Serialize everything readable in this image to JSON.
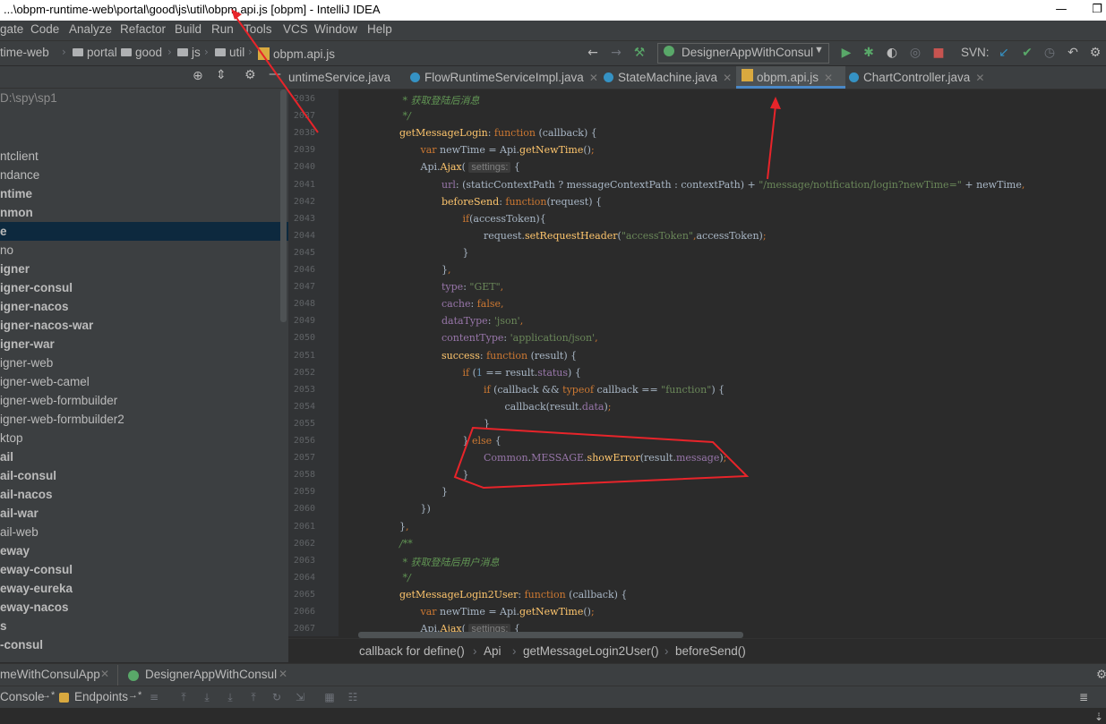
{
  "window": {
    "title": "...\\obpm-runtime-web\\portal\\good\\js\\util\\obpm.api.js [obpm] - IntelliJ IDEA",
    "minimize": "—",
    "restore": "❐"
  },
  "menu": [
    "gate",
    "Code",
    "Analyze",
    "Refactor",
    "Build",
    "Run",
    "Tools",
    "VCS",
    "Window",
    "Help"
  ],
  "nav": {
    "crumbs": [
      "time-web",
      "portal",
      "good",
      "js",
      "util",
      "obpm.api.js"
    ],
    "run_config": "DesignerAppWithConsul",
    "svn_label": "SVN:"
  },
  "project": {
    "root_path": "D:\\spy\\sp1",
    "items": [
      {
        "label": "ntclient",
        "bold": false
      },
      {
        "label": "ndance",
        "bold": false
      },
      {
        "label": "ntime",
        "bold": true
      },
      {
        "label": "nmon",
        "bold": true
      },
      {
        "label": "e",
        "bold": true,
        "selected": true
      },
      {
        "label": "no",
        "bold": false
      },
      {
        "label": "igner",
        "bold": true
      },
      {
        "label": "igner-consul",
        "bold": true
      },
      {
        "label": "igner-nacos",
        "bold": true
      },
      {
        "label": "igner-nacos-war",
        "bold": true
      },
      {
        "label": "igner-war",
        "bold": true
      },
      {
        "label": "igner-web",
        "bold": false
      },
      {
        "label": "igner-web-camel",
        "bold": false
      },
      {
        "label": "igner-web-formbuilder",
        "bold": false
      },
      {
        "label": "igner-web-formbuilder2",
        "bold": false
      },
      {
        "label": "ktop",
        "bold": false
      },
      {
        "label": "ail",
        "bold": true
      },
      {
        "label": "ail-consul",
        "bold": true
      },
      {
        "label": "ail-nacos",
        "bold": true
      },
      {
        "label": "ail-war",
        "bold": true
      },
      {
        "label": "ail-web",
        "bold": false
      },
      {
        "label": "eway",
        "bold": true
      },
      {
        "label": "eway-consul",
        "bold": true
      },
      {
        "label": "eway-eureka",
        "bold": true
      },
      {
        "label": "eway-nacos",
        "bold": true
      },
      {
        "label": "s",
        "bold": true
      },
      {
        "label": "-consul",
        "bold": true
      }
    ]
  },
  "tabs": [
    {
      "label": "untimeService.java",
      "icon": "java-class-icon",
      "active": false
    },
    {
      "label": "FlowRuntimeServiceImpl.java",
      "icon": "java-class-icon",
      "active": false
    },
    {
      "label": "StateMachine.java",
      "icon": "java-class-icon",
      "active": false
    },
    {
      "label": "obpm.api.js",
      "icon": "js-file-icon",
      "active": true
    },
    {
      "label": "ChartController.java",
      "icon": "java-class-icon",
      "active": false
    }
  ],
  "editor": {
    "line_numbers": [
      "2036",
      "2037",
      "2038",
      "2039",
      "2040",
      "2041",
      "2042",
      "2043",
      "2044",
      "2045",
      "2046",
      "2047",
      "2048",
      "2049",
      "2050",
      "2051",
      "2052",
      "2053",
      "2054",
      "2055",
      "2056",
      "2057",
      "2058",
      "2059",
      "2060",
      "2061",
      "2062",
      "2063",
      "2064",
      "2065",
      "2066",
      "2067"
    ],
    "lines": [
      {
        "indent": 1,
        "parts": [
          {
            "c": "cm",
            "t": " * 获取登陆后消息"
          }
        ]
      },
      {
        "indent": 1,
        "parts": [
          {
            "c": "cm",
            "t": " */"
          }
        ]
      },
      {
        "indent": 1,
        "parts": [
          {
            "c": "fn",
            "t": "getMessageLogin"
          },
          {
            "c": "",
            "t": ": "
          },
          {
            "c": "kw",
            "t": "function "
          },
          {
            "c": "",
            "t": "(callback) {"
          }
        ]
      },
      {
        "indent": 2,
        "parts": [
          {
            "c": "kw",
            "t": "var "
          },
          {
            "c": "",
            "t": "newTime = Api."
          },
          {
            "c": "fn",
            "t": "getNewTime"
          },
          {
            "c": "",
            "t": "()"
          },
          {
            "c": "kw",
            "t": ";"
          }
        ]
      },
      {
        "indent": 2,
        "parts": [
          {
            "c": "",
            "t": "Api."
          },
          {
            "c": "fn",
            "t": "Ajax"
          },
          {
            "c": "",
            "t": "( "
          },
          {
            "c": "hint",
            "t": "settings:"
          },
          {
            "c": "",
            "t": " {"
          }
        ]
      },
      {
        "indent": 3,
        "parts": [
          {
            "c": "pr",
            "t": "url"
          },
          {
            "c": "",
            "t": ": (staticContextPath ? messageContextPath : contextPath) + "
          },
          {
            "c": "st",
            "t": "\"/message/notification/login?newTime=\""
          },
          {
            "c": "",
            "t": " + newTime"
          },
          {
            "c": "kw",
            "t": ","
          }
        ]
      },
      {
        "indent": 3,
        "parts": [
          {
            "c": "fn",
            "t": "beforeSend"
          },
          {
            "c": "",
            "t": ": "
          },
          {
            "c": "kw",
            "t": "function"
          },
          {
            "c": "",
            "t": "(request) {"
          }
        ]
      },
      {
        "indent": 4,
        "parts": [
          {
            "c": "kw",
            "t": "if"
          },
          {
            "c": "",
            "t": "(accessToken){"
          }
        ]
      },
      {
        "indent": 5,
        "parts": [
          {
            "c": "",
            "t": "request."
          },
          {
            "c": "fn",
            "t": "setRequestHeader"
          },
          {
            "c": "",
            "t": "("
          },
          {
            "c": "st",
            "t": "\"accessToken\""
          },
          {
            "c": "kw",
            "t": ","
          },
          {
            "c": "",
            "t": "accessToken)"
          },
          {
            "c": "kw",
            "t": ";"
          }
        ]
      },
      {
        "indent": 4,
        "parts": [
          {
            "c": "",
            "t": "}"
          }
        ]
      },
      {
        "indent": 3,
        "parts": [
          {
            "c": "",
            "t": "}"
          },
          {
            "c": "kw",
            "t": ","
          }
        ]
      },
      {
        "indent": 3,
        "parts": [
          {
            "c": "pr",
            "t": "type"
          },
          {
            "c": "",
            "t": ": "
          },
          {
            "c": "st",
            "t": "\"GET\""
          },
          {
            "c": "kw",
            "t": ","
          }
        ]
      },
      {
        "indent": 3,
        "parts": [
          {
            "c": "pr",
            "t": "cache"
          },
          {
            "c": "",
            "t": ": "
          },
          {
            "c": "kw",
            "t": "false,"
          }
        ]
      },
      {
        "indent": 3,
        "parts": [
          {
            "c": "pr",
            "t": "dataType"
          },
          {
            "c": "",
            "t": ": "
          },
          {
            "c": "st",
            "t": "'json'"
          },
          {
            "c": "kw",
            "t": ","
          }
        ]
      },
      {
        "indent": 3,
        "parts": [
          {
            "c": "pr",
            "t": "contentType"
          },
          {
            "c": "",
            "t": ": "
          },
          {
            "c": "st",
            "t": "'application/json'"
          },
          {
            "c": "kw",
            "t": ","
          }
        ]
      },
      {
        "indent": 3,
        "parts": [
          {
            "c": "fn",
            "t": "success"
          },
          {
            "c": "",
            "t": ": "
          },
          {
            "c": "kw",
            "t": "function "
          },
          {
            "c": "",
            "t": "(result) {"
          }
        ]
      },
      {
        "indent": 4,
        "parts": [
          {
            "c": "kw",
            "t": "if "
          },
          {
            "c": "",
            "t": "("
          },
          {
            "c": "nm",
            "t": "1"
          },
          {
            "c": "",
            "t": " == result."
          },
          {
            "c": "pr",
            "t": "status"
          },
          {
            "c": "",
            "t": ") {"
          }
        ]
      },
      {
        "indent": 5,
        "parts": [
          {
            "c": "kw",
            "t": "if "
          },
          {
            "c": "",
            "t": "(callback && "
          },
          {
            "c": "kw",
            "t": "typeof "
          },
          {
            "c": "",
            "t": "callback == "
          },
          {
            "c": "st",
            "t": "\"function\""
          },
          {
            "c": "",
            "t": ") {"
          }
        ]
      },
      {
        "indent": 6,
        "parts": [
          {
            "c": "",
            "t": "callback(result."
          },
          {
            "c": "pr",
            "t": "data"
          },
          {
            "c": "",
            "t": ")"
          },
          {
            "c": "kw",
            "t": ";"
          }
        ]
      },
      {
        "indent": 5,
        "parts": [
          {
            "c": "",
            "t": "}"
          }
        ]
      },
      {
        "indent": 4,
        "parts": [
          {
            "c": "",
            "t": "} "
          },
          {
            "c": "kw",
            "t": "else "
          },
          {
            "c": "",
            "t": "{"
          }
        ]
      },
      {
        "indent": 5,
        "parts": [
          {
            "c": "pr",
            "t": "Common"
          },
          {
            "c": "",
            "t": "."
          },
          {
            "c": "pr",
            "t": "MESSAGE"
          },
          {
            "c": "",
            "t": "."
          },
          {
            "c": "fn",
            "t": "showError"
          },
          {
            "c": "",
            "t": "(result."
          },
          {
            "c": "pr",
            "t": "message"
          },
          {
            "c": "",
            "t": ")"
          },
          {
            "c": "kw",
            "t": ";"
          }
        ]
      },
      {
        "indent": 4,
        "parts": [
          {
            "c": "",
            "t": "}"
          }
        ]
      },
      {
        "indent": 3,
        "parts": [
          {
            "c": "",
            "t": "}"
          }
        ]
      },
      {
        "indent": 2,
        "parts": [
          {
            "c": "",
            "t": "})"
          }
        ]
      },
      {
        "indent": 1,
        "parts": [
          {
            "c": "",
            "t": "}"
          },
          {
            "c": "kw",
            "t": ","
          }
        ]
      },
      {
        "indent": 1,
        "parts": [
          {
            "c": "cm",
            "t": "/**"
          }
        ]
      },
      {
        "indent": 1,
        "parts": [
          {
            "c": "cm",
            "t": " * 获取登陆后用户消息"
          }
        ]
      },
      {
        "indent": 1,
        "parts": [
          {
            "c": "cm",
            "t": " */"
          }
        ]
      },
      {
        "indent": 1,
        "parts": [
          {
            "c": "fn",
            "t": "getMessageLogin2User"
          },
          {
            "c": "",
            "t": ": "
          },
          {
            "c": "kw",
            "t": "function "
          },
          {
            "c": "",
            "t": "(callback) {"
          }
        ]
      },
      {
        "indent": 2,
        "parts": [
          {
            "c": "kw",
            "t": "var "
          },
          {
            "c": "",
            "t": "newTime = Api."
          },
          {
            "c": "fn",
            "t": "getNewTime"
          },
          {
            "c": "",
            "t": "()"
          },
          {
            "c": "kw",
            "t": ";"
          }
        ]
      },
      {
        "indent": 2,
        "parts": [
          {
            "c": "",
            "t": "Api."
          },
          {
            "c": "fn",
            "t": "Ajax"
          },
          {
            "c": "",
            "t": "( "
          },
          {
            "c": "hint",
            "t": "settings:"
          },
          {
            "c": "",
            "t": " {"
          }
        ]
      }
    ]
  },
  "breadcrumb": [
    "callback for define()",
    "Api",
    "getMessageLogin2User()",
    "beforeSend()"
  ],
  "run_tabs": [
    "meWithConsulApp",
    "DesignerAppWithConsul"
  ],
  "run_tool": {
    "console": "Console",
    "endpoints": "Endpoints"
  },
  "colors": {
    "annotation": "#e8242a",
    "accent": "#4a88c7"
  }
}
